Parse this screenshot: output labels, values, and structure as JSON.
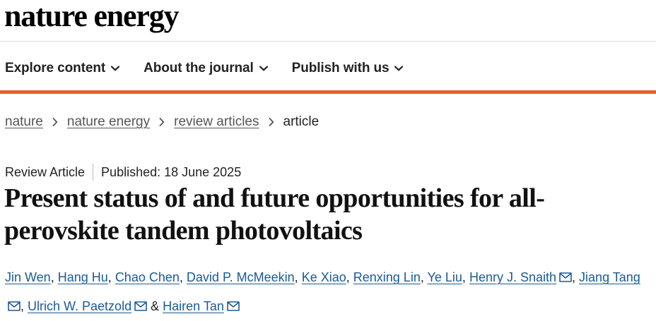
{
  "logo": {
    "text": "nature energy"
  },
  "nav": {
    "items": [
      {
        "label": "Explore content"
      },
      {
        "label": "About the journal"
      },
      {
        "label": "Publish with us"
      }
    ]
  },
  "breadcrumb": {
    "items": [
      {
        "label": "nature"
      },
      {
        "label": "nature energy"
      },
      {
        "label": "review articles"
      }
    ],
    "current": "article"
  },
  "article": {
    "type": "Review Article",
    "published": "Published: 18 June 2025",
    "title": "Present status of and future opportunities for all-perovskite tandem photovoltaics",
    "authors": [
      "Jin Wen",
      "Hang Hu",
      "Chao Chen",
      "David P. McMeekin",
      "Ke Xiao",
      "Renxing Lin",
      "Ye Liu",
      "Henry J. Snaith",
      "Jiang Tang",
      "Ulrich W. Paetzold",
      "Hairen Tan"
    ],
    "author_separator": ",",
    "last_author_separator": "&"
  },
  "colors": {
    "accent_bar": "#e3612c",
    "author_link": "#1b5a94",
    "breadcrumb_link": "#555555"
  },
  "icons": {
    "nav_chevron": "chevron-down-icon",
    "breadcrumb_separator": "chevron-right-icon",
    "corresponding_author": "envelope-icon"
  }
}
